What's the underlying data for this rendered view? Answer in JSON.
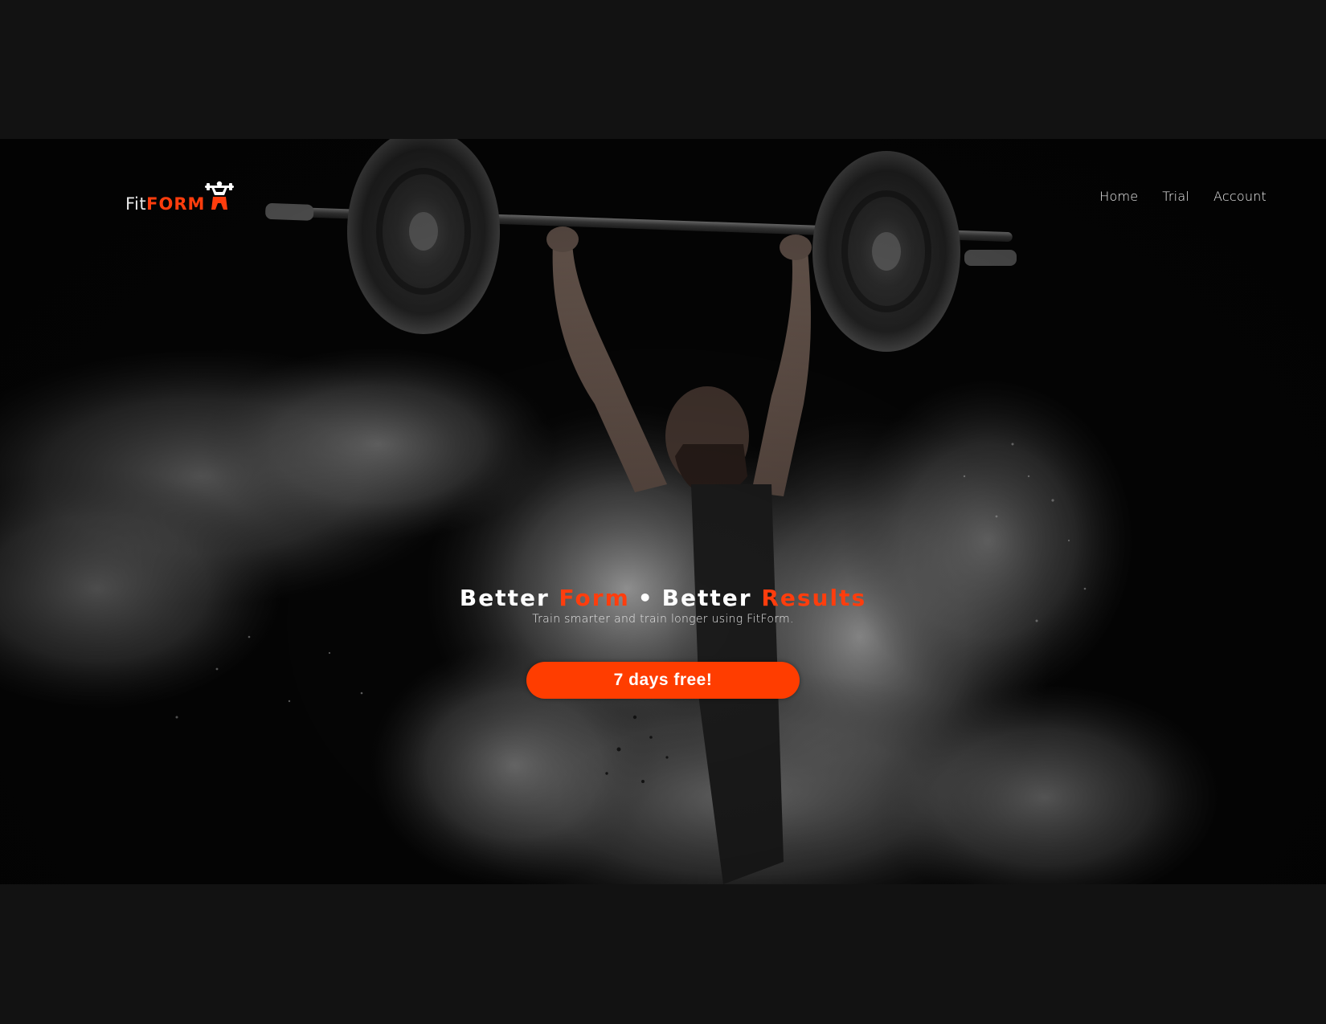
{
  "brand": {
    "name_part_1": "Fit",
    "name_part_2": "FORM",
    "accent_color": "#ff3d0d"
  },
  "nav": {
    "items": [
      {
        "label": "Home"
      },
      {
        "label": "Trial"
      },
      {
        "label": "Account"
      }
    ]
  },
  "hero": {
    "headline_word_1": "Better",
    "headline_word_2": "Form",
    "headline_separator": "•",
    "headline_word_3": "Better",
    "headline_word_4": "Results",
    "subheadline": "Train smarter and train longer using FitForm.",
    "cta_label": "7 days free!",
    "background_image": "weightlifter-chalk-cloud-photo"
  },
  "colors": {
    "page_background": "#121212",
    "cta_background": "#ff3d00",
    "text_primary": "#ffffff"
  }
}
